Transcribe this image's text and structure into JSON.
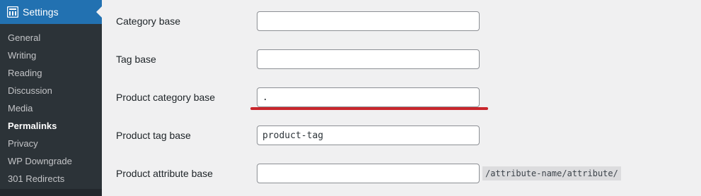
{
  "sidebar": {
    "menu_title": "Settings",
    "menu_icon": "settings-sliders-icon",
    "items": [
      {
        "label": "General"
      },
      {
        "label": "Writing"
      },
      {
        "label": "Reading"
      },
      {
        "label": "Discussion"
      },
      {
        "label": "Media"
      },
      {
        "label": "Permalinks",
        "current": true
      },
      {
        "label": "Privacy"
      },
      {
        "label": "WP Downgrade"
      },
      {
        "label": "301 Redirects"
      }
    ]
  },
  "fields": [
    {
      "label": "Category base",
      "value": ""
    },
    {
      "label": "Tag base",
      "value": ""
    },
    {
      "label": "Product category base",
      "value": "."
    },
    {
      "label": "Product tag base",
      "value": "product-tag"
    },
    {
      "label": "Product attribute base",
      "value": "",
      "hint": "/attribute-name/attribute/"
    }
  ],
  "colors": {
    "sidebar_bg": "#2c3338",
    "accent": "#2271b1",
    "annotation": "#c9262c"
  }
}
